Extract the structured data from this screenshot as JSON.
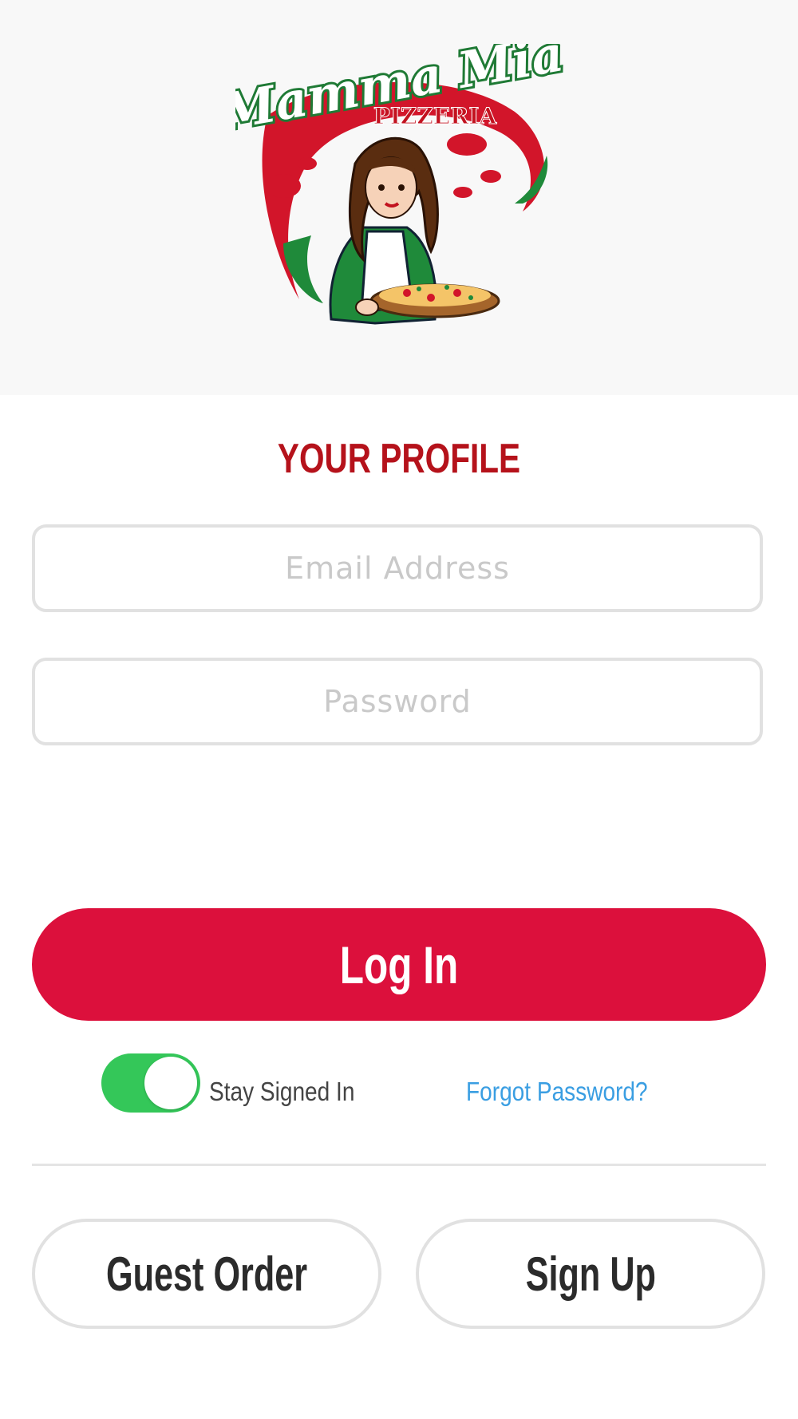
{
  "logo": {
    "brand_name": "Mamma Mia",
    "brand_sub": "PIZZERIA"
  },
  "profile": {
    "title": "YOUR PROFILE"
  },
  "form": {
    "email_placeholder": "Email Address",
    "email_value": "",
    "password_placeholder": "Password",
    "password_value": ""
  },
  "actions": {
    "login_label": "Log In",
    "stay_signed_in_label": "Stay Signed In",
    "stay_signed_in_on": true,
    "forgot_password_label": "Forgot Password?",
    "guest_order_label": "Guest Order",
    "sign_up_label": "Sign Up"
  },
  "colors": {
    "title_red": "#b5121b",
    "login_red": "#dc103c",
    "toggle_green": "#34c759",
    "link_blue": "#3a9ee2",
    "logo_green": "#1f7a35"
  },
  "icons": {
    "logo": "mamma-mia-chef-logo"
  }
}
